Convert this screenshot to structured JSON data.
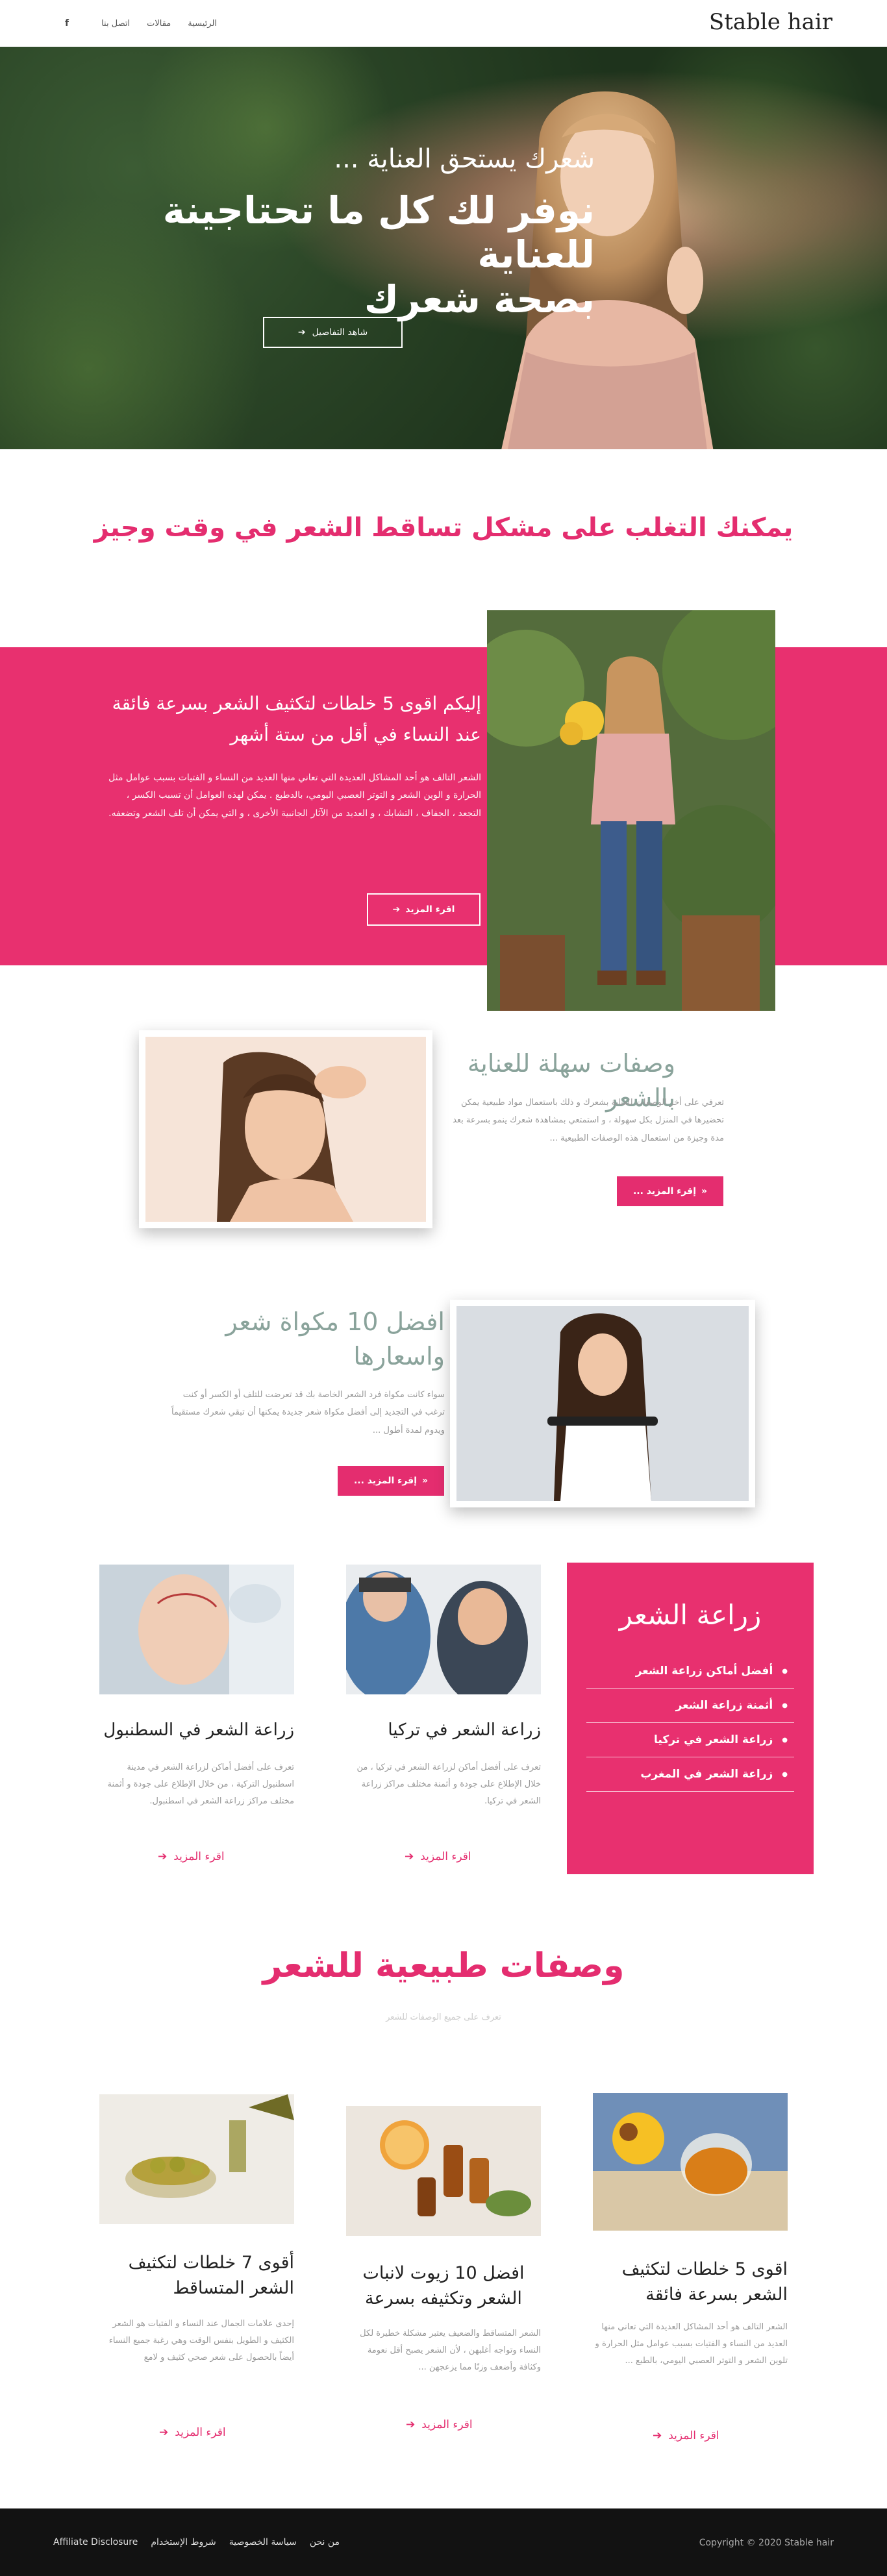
{
  "header": {
    "brand": "Stable hair",
    "nav": [
      "الرئيسية",
      "مقالات",
      "اتصل بنا"
    ],
    "facebook_icon": "facebook-icon"
  },
  "hero": {
    "subtitle": "شعرك يستحق العناية ...",
    "title_line1": "نوفر لك كل ما تحتاجينة للعناية",
    "title_line2": "بصحة شعرك",
    "button": "شاهد التفاصيل",
    "button_icon": "arrow-right-icon"
  },
  "intro": {
    "title": "يمكنك التغلب على مشكل تساقط الشعر في وقت وجيز"
  },
  "feature": {
    "title_line1": "إليكم اقوى 5 خلطات لتكثيف الشعر بسرعة فائقة",
    "title_line2": "عند النساء في أقل من ستة أشهر",
    "body": "الشعر التالف هو أحد المشاكل العديدة التي تعاني منها العديد من النساء و الفتيات بسبب عوامل مثل الحرارة و الوين الشعر و التوتر العصبي اليومي، بالدطبع . يمكن لهذه العوامل أن تسبب الكسر ، التجعد ، الجفاف ، التشابك ، و العديد من الآثار الجانبية الأخرى ، و التي يمكن أن تلف الشعر وتضعفه.",
    "button": "اقرء المزيد"
  },
  "articles": [
    {
      "title": "وصفات سهلة للعناية بالشعر",
      "body": "تعرفي على أخر الوصفات للعناية بشعرك و ذلك باستعمال مواد طبيعية يمكن تحضيرها في المنزل بكل سهولة ، و استمتعي بمشاهدة شعرك ينمو بسرعة بعد مدة وجيزة من استعمال هذه الوصفات الطبيعية ...",
      "button": "إقرء المزيد ..."
    },
    {
      "title_line1": "افضل 10 مكواة شعر",
      "title_line2": "واسعارها",
      "body": "سواء كانت مكواة فرد الشعر الخاصة بك قد تعرضت للتلف أو الكسر أو كنت ترغب في التجديد إلى أفضل مكواة شعر جديدة يمكنها أن تبقي شعرك مستقيماً ويدوم لمدة أطول ...",
      "button": "إقرء المزيد ..."
    }
  ],
  "transplant": {
    "box_title": "زراعة الشعر",
    "list": [
      "أفضل أماكن زراعة الشعر",
      "أثمنة زراعة الشعر",
      "زراعة الشعر في تركيا",
      "زراعة الشعر في المغرب"
    ],
    "cards": [
      {
        "title": "زراعة الشعر في تركيا",
        "body": "تعرف على أفضل أماكن لزراعة الشعر في تركيا ، من خلال الإطلاع على جودة و أثمنة مختلف مراكز زراعة الشعر في تركيا.",
        "read_more": "اقرء المزيد"
      },
      {
        "title": "زراعة الشعر في السطنبول",
        "body": "تعرف على أفضل أماكن لزراعة الشعر في مدينة اسطنبول التركية ، من خلال الإطلاع على جودة و أثمنة مختلف مراكز زراعة الشعر في اسطنبول.",
        "read_more": "اقرء المزيد"
      }
    ]
  },
  "natural": {
    "title": "وصفات طبيعية للشعر",
    "subtitle": "تعرف على جميع الوصفات للشعر",
    "cards": [
      {
        "title": "اقوى 5 خلطات لتكثيف الشعر بسرعة فائقة",
        "body": "الشعر التالف هو أحد المشاكل العديدة التي تعاني منها العديد من النساء و الفتيات بسبب عوامل مثل الحرارة و تلوين الشعر و التوتر العصبي اليومي، بالطبع ...",
        "read_more": "اقرء المزيد"
      },
      {
        "title": "افضل 10 زيوت لانبات الشعر وتكثيفه بسرعة",
        "body": "الشعر المتساقط والضعيف يعتبر مشكلة خطيرة لكل النساء وتواجه أغلبهن ، لأن الشعر يصبح أقل نعومة وكثافة وأضعف وزنًا مما يزعجهن ...",
        "read_more": "اقرء المزيد"
      },
      {
        "title": "أقوى 7 خلطات لتكثيف الشعر المتساقط",
        "body": "إحدى علامات الجمال عند النساء و الفتيات هو الشعر الكثيف و الطويل بنفس الوقت وهي رغبة جميع النساء أيضاً بالحصول على شعر صحي كثيف و لامع",
        "read_more": "اقرء المزيد"
      }
    ]
  },
  "footer": {
    "links": [
      "Affiliate Disclosure",
      "شروط الإستخدام",
      "سياسة الخصوصية",
      "من نحن"
    ],
    "copyright": "Copyright © 2020 Stable hair"
  },
  "colors": {
    "accent": "#e42d6f",
    "band": "#e8306f",
    "muted_title": "#8aa39b",
    "footer": "#121212"
  }
}
